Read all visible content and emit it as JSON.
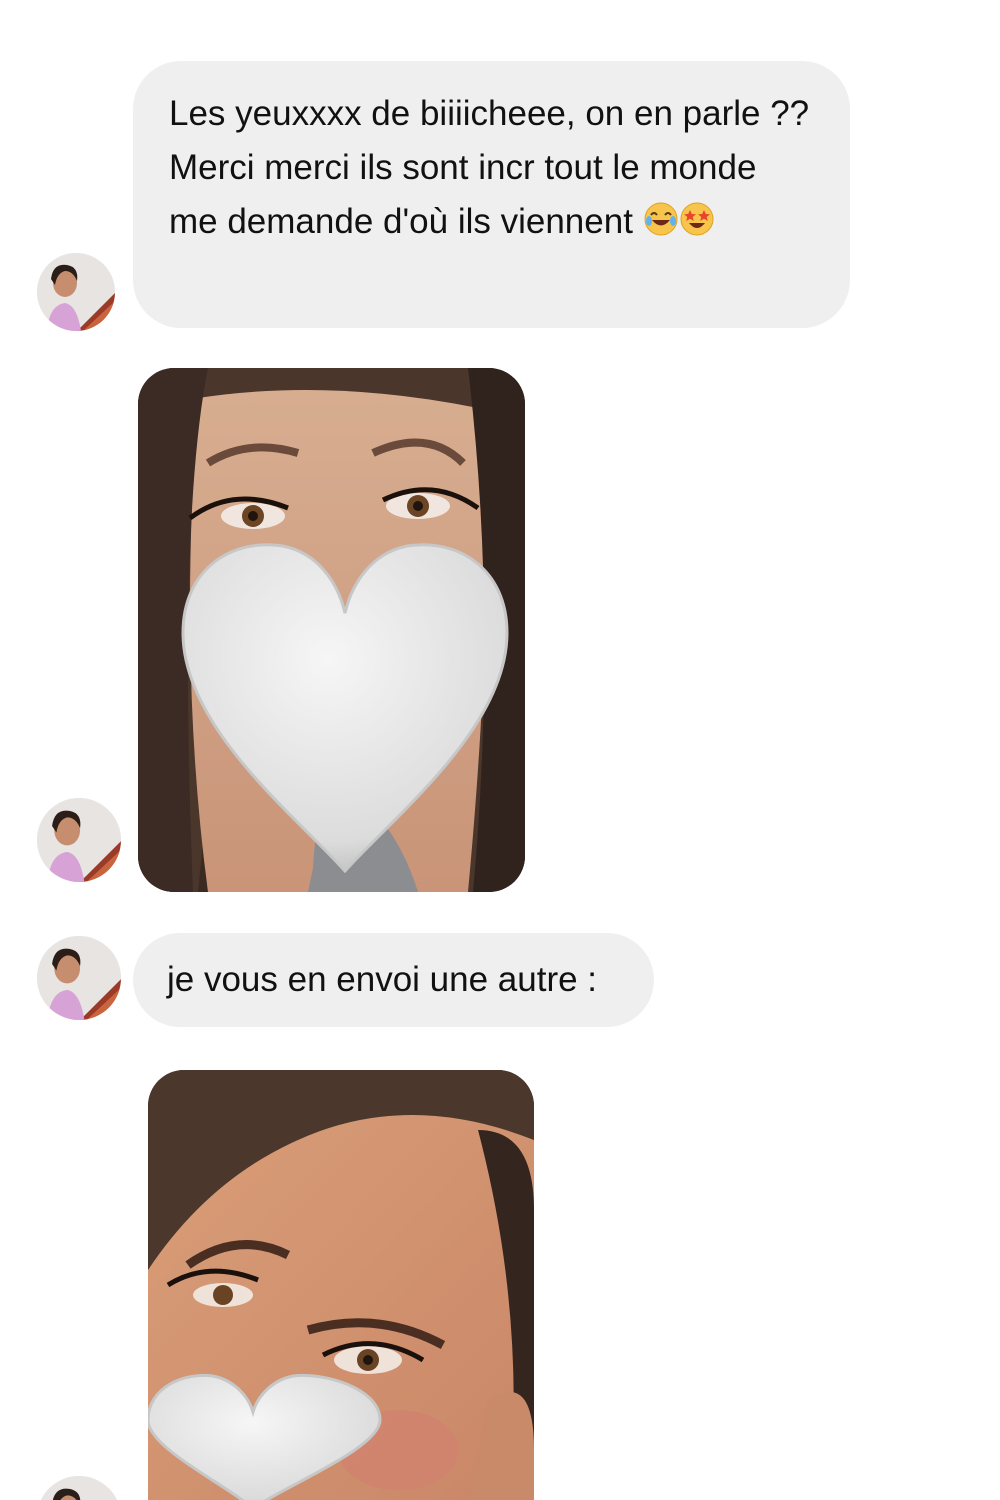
{
  "messages": [
    {
      "text": "Les yeuxxxx de biiiicheee, on en parle ?? Merci merci ils sont incr tout le monde me demande d'où ils viennent",
      "emojis": [
        "face-with-tears-of-joy",
        "star-struck"
      ]
    },
    {
      "text": "je vous en envoi une autre :"
    }
  ],
  "colors": {
    "bubble_bg": "#efefef",
    "text": "#111111",
    "background": "#ffffff"
  }
}
